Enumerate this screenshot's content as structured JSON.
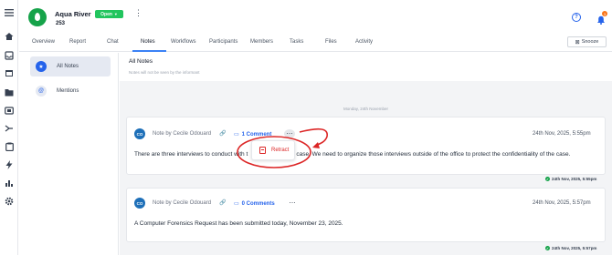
{
  "rail": {
    "icons": [
      "menu-icon",
      "home-icon",
      "inbox-icon",
      "calendar-icon",
      "folder-icon",
      "media-icon",
      "workflow-icon",
      "clipboard-icon",
      "bolt-icon",
      "chart-icon",
      "settings-icon"
    ]
  },
  "header": {
    "title": "Aqua River",
    "subtitle": "253",
    "status": "Open",
    "more": "⋮",
    "help": "?",
    "notification_count": "3"
  },
  "tabs": {
    "items": [
      "Overview",
      "Report",
      "Chat",
      "Notes",
      "Workflows",
      "Participants",
      "Members",
      "Tasks",
      "Files",
      "Activity"
    ],
    "active": "Notes",
    "snooze_label": "Snooze"
  },
  "side": {
    "all_notes": "All Notes",
    "mentions": "Mentions"
  },
  "main": {
    "title": "All Notes",
    "subtitle": "Notes will not be seen by the informant",
    "day_separator": "Monday, 24th November"
  },
  "notes": [
    {
      "initials": "CO",
      "author": "Note by Cecile Odouard",
      "comments": "1 Comment",
      "time": "24th Nov, 2025, 5:55pm",
      "body_left": "There are three interviews to conduct with t",
      "body_right": "s case. We need to organize those interviews outside of the office to protect the confidentiality of the case.",
      "receipt": "24th Nov, 2025, 5:55pm"
    },
    {
      "initials": "CO",
      "author": "Note by Cecile Odouard",
      "comments": "0 Comments",
      "time": "24th Nov, 2025, 5:57pm",
      "body": "A Computer Forensics Request has been submitted today, November 23, 2025.",
      "receipt": "24th Nov, 2025, 5:57pm"
    }
  ],
  "popup": {
    "retract_label": "Retract"
  },
  "colors": {
    "accent": "#2563eb",
    "status_green": "#22c55e",
    "annotation_red": "#dc2626"
  }
}
